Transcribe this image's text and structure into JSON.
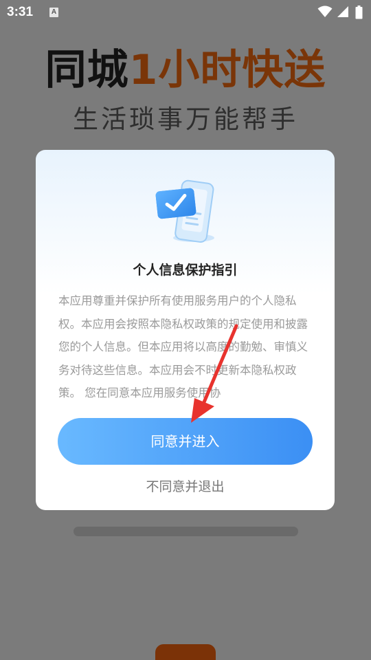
{
  "status_bar": {
    "time": "3:31",
    "notification_icon_letter": "A",
    "icons": [
      "wifi-icon",
      "signal-icon",
      "battery-icon"
    ]
  },
  "background": {
    "title_part1": "同城",
    "title_part2": "1小时快送",
    "subtitle": "生活琐事万能帮手",
    "colors": {
      "title_dark": "#111111",
      "title_accent": "#7a3508",
      "overlay": "#7b7b7b"
    }
  },
  "dialog": {
    "illustration_icon": "document-check-icon",
    "title": "个人信息保护指引",
    "body": "本应用尊重并保护所有使用服务用户的个人隐私权。本应用会按照本隐私权政策的规定使用和披露您的个人信息。但本应用将以高度的勤勉、审慎义务对待这些信息。本应用会不时更新本隐私权政策。 您在同意本应用服务使用协",
    "agree_label": "同意并进入",
    "disagree_label": "不同意并退出",
    "colors": {
      "button_start": "#69b9ff",
      "button_end": "#3b8ff4"
    }
  },
  "annotation": {
    "arrow_color": "#e8332e",
    "arrow_icon": "red-arrow-icon"
  }
}
